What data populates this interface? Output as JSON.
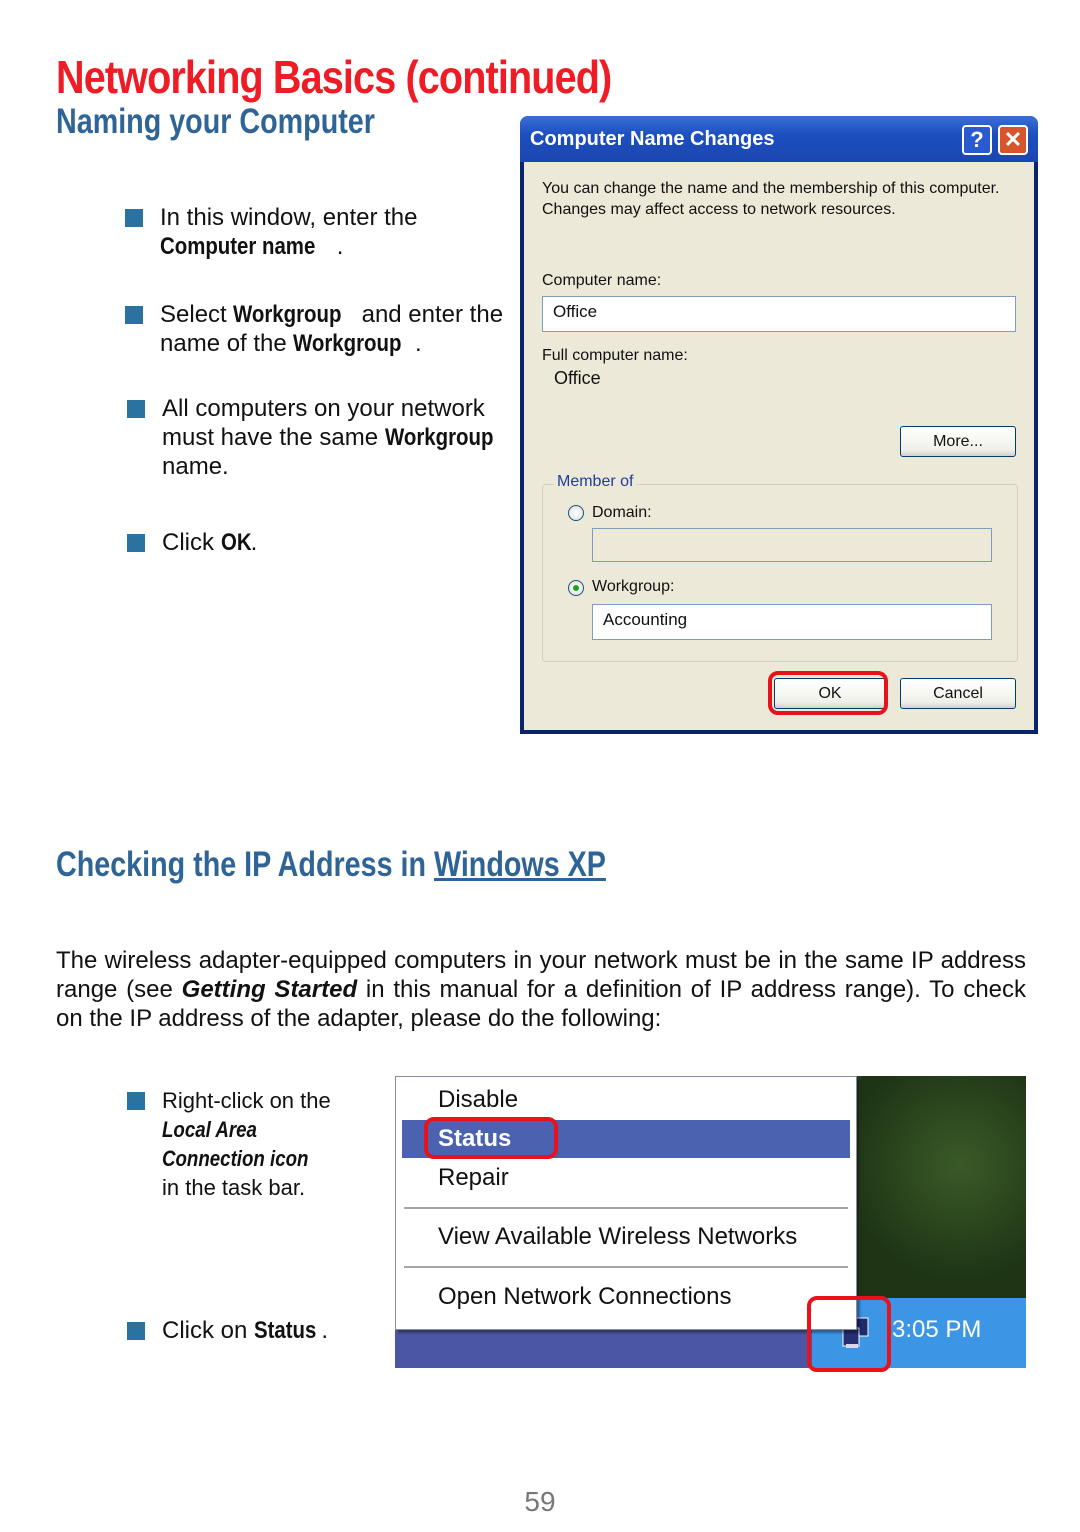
{
  "page": {
    "title": "Networking Basics (continued)",
    "page_number": "59",
    "accent_colors": {
      "title_red": "#ee1c25",
      "heading_blue": "#2f6496",
      "bullet_blue": "#2a73a0",
      "callout_red": "#e8121c"
    }
  },
  "section1": {
    "title": "Naming your Computer",
    "bullets": [
      {
        "pre": "In this window, enter the ",
        "bold": "Computer  name",
        "post": "."
      },
      {
        "pre": "Select ",
        "bold": "Workgroup",
        "mid": " and enter the name of the ",
        "bold2": "Workgroup",
        "post": "."
      },
      {
        "pre": "All computers on your network must have the same ",
        "bold": "Workgroup",
        "post": " name."
      },
      {
        "pre": "Click ",
        "bold": "OK",
        "post": "."
      }
    ]
  },
  "dialog": {
    "title": "Computer Name Changes",
    "help_icon": "help-icon",
    "close_icon": "close-icon",
    "description": "You can change the name and the membership of this computer. Changes may affect access to network resources.",
    "computer_name_label": "Computer name:",
    "computer_name_value": "Office",
    "full_name_label": "Full computer name:",
    "full_name_value": "Office",
    "more_button": "More...",
    "member_of_label": "Member of",
    "domain_label": "Domain:",
    "domain_value": "",
    "domain_selected": false,
    "workgroup_label": "Workgroup:",
    "workgroup_value": "Accounting",
    "workgroup_selected": true,
    "ok_button": "OK",
    "cancel_button": "Cancel"
  },
  "section2": {
    "title_pre": "Checking the IP Address in ",
    "title_link": "Windows XP",
    "intro_pre": "The wireless adapter-equipped computers in your network must be in the same IP address range (see ",
    "intro_bold": "Getting Started",
    "intro_post": " in this manual for a definition of IP address range). To check on the IP address of the adapter, please do the following:",
    "bullets": [
      {
        "pre": "Right-click on the ",
        "bold": "Local Area Connection icon",
        "post": " in the task bar."
      },
      {
        "pre": "Click on ",
        "bold": "Status",
        "post": "."
      }
    ]
  },
  "context_menu": {
    "items": [
      {
        "label": "Disable",
        "selected": false
      },
      {
        "label": "Status",
        "selected": true
      },
      {
        "label": "Repair",
        "selected": false
      },
      {
        "label": "View Available Wireless Networks",
        "selected": false
      },
      {
        "label": "Open Network Connections",
        "selected": false
      }
    ],
    "network_icon": "network-connection-icon",
    "clock": "3:05 PM"
  }
}
